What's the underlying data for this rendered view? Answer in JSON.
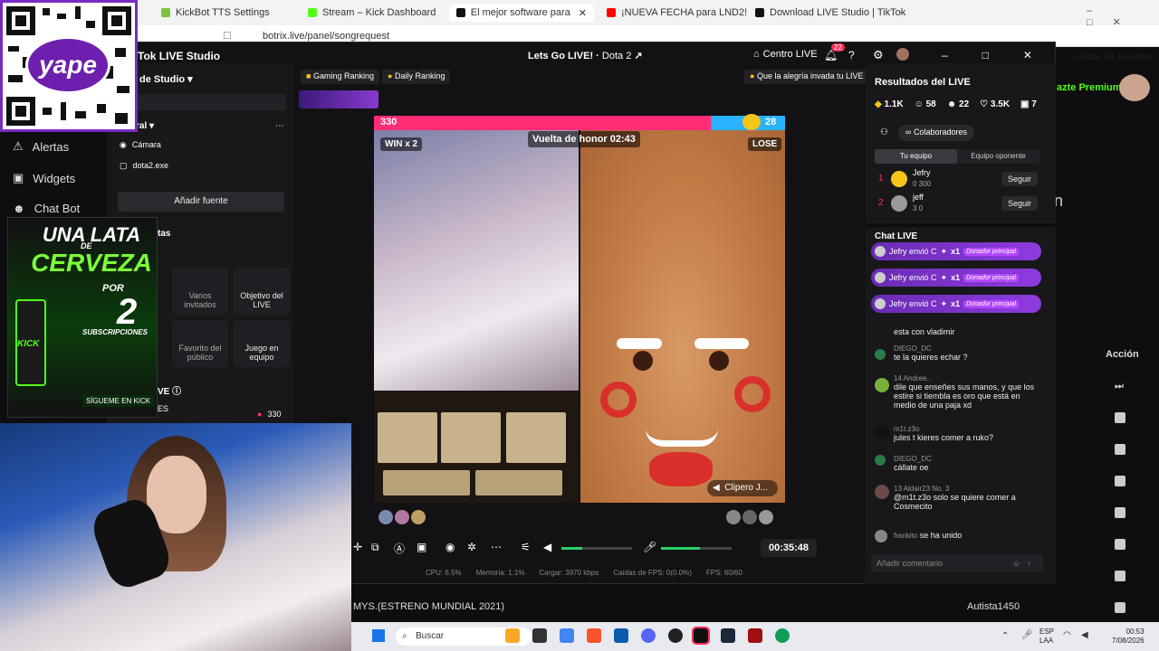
{
  "browser": {
    "tabs": [
      {
        "label": "KickBot TTS Settings",
        "color": "#7fc241"
      },
      {
        "label": "Stream – Kick Dashboard",
        "color": "#53fc18"
      },
      {
        "label": "El mejor software para potencia",
        "color": "#111111"
      },
      {
        "label": "¡NUEVA FECHA para LND2!",
        "color": "#ff0000"
      },
      {
        "label": "Download LIVE Studio | TikTok",
        "color": "#111111"
      }
    ],
    "url": "botrix.live/panel/songrequest",
    "bookmark": "Todos los favoritos"
  },
  "page": {
    "sidebar": [
      "Alertas",
      "Widgets",
      "Chat Bot"
    ],
    "premium": "azte Premium",
    "accion": "Acción",
    "song_title": "MYS.(ESTRENO MUNDIAL 2021)",
    "song_user": "Autista1450"
  },
  "studio": {
    "title": "Tok LIVE Studio",
    "live_title": "Lets Go LIVE!",
    "game": "Dota 2",
    "centro": "Centro LIVE",
    "notif_count": "22",
    "scene_label": "de Studio",
    "section_general": "ral",
    "sources": [
      "Cámara",
      "dota2.exe"
    ],
    "add_source": "Añadir fuente",
    "section_herramientas": "tas",
    "tools": [
      {
        "label": "Varios invitados"
      },
      {
        "label": "Objetivo del LIVE"
      },
      {
        "label": "Favorito del público"
      },
      {
        "label": "Juego en equipo"
      }
    ],
    "section_live": "VE",
    "section_es": "ES",
    "coins": "330",
    "rankings": [
      "Gaming Ranking",
      "Daily Ranking"
    ],
    "alegria": "Que la alegría invada tu LIVE",
    "pk": {
      "left_score": "330",
      "right_score": "28",
      "win": "WIN x 2",
      "lose": "LOSE",
      "honor": "Vuelta de honor 02:43",
      "clipper": "Clipero J..."
    },
    "timer": "00:35:48",
    "stats": [
      "CPU: 6.5%",
      "Memoria: 1.1%",
      "Cargar: 3970 kbps",
      "Caídas de FPS: 0(0.0%)",
      "FPS: 60/60"
    ]
  },
  "results": {
    "title": "Resultados del LIVE",
    "counts": [
      "1.1K",
      "58",
      "22",
      "3.5K",
      "7"
    ],
    "colaboradores": "Colaboradores",
    "team_tabs": [
      "Tu equipo",
      "Equipo oponente"
    ],
    "team": [
      {
        "rank": "1",
        "name": "Jefry",
        "stats": "0  300",
        "action": "Seguir"
      },
      {
        "rank": "2",
        "name": "jeff",
        "stats": "3  0",
        "action": "Seguir"
      }
    ],
    "chat_title": "Chat LIVE",
    "gifts": [
      {
        "text": "Jefry envió C",
        "mult": "x1",
        "badge": "Donador principal"
      },
      {
        "text": "Jefry envió C",
        "mult": "x1",
        "badge": "Donador principal"
      },
      {
        "text": "Jefry envió C",
        "mult": "x1",
        "badge": "Donador principal"
      }
    ],
    "messages": [
      {
        "user": "",
        "text": "esta con vladimir"
      },
      {
        "user": "DIEGO_DC",
        "text": "te la quieres echar ?"
      },
      {
        "user": "14  Andree..",
        "text": "dile que enseñes sus manos, y que los estire si tiembla es oro que está en medio de una paja xd"
      },
      {
        "user": "m1t.z3o",
        "text": "jules t kieres comer a ruko?"
      },
      {
        "user": "DIEGO_DC",
        "text": "cállate oe"
      },
      {
        "user": "13  Aldair23  No. 3",
        "text": "@m1t.z3o solo se quiere comer a Cosmecito"
      },
      {
        "user": "frankito",
        "text": "se ha unido"
      }
    ],
    "comment_placeholder": "Añadir comentario"
  },
  "overlays": {
    "yape": "yape",
    "kick_ad": [
      "UNA LATA",
      "DE",
      "CERVEZA",
      "POR",
      "2",
      "SUBSCRIPCIONES",
      "KICK",
      "SÍGUEME EN KICK"
    ]
  },
  "taskbar": {
    "search": "Buscar",
    "lang": "ESP\nLAA",
    "time": "00:53",
    "date": "7/08/2026"
  }
}
